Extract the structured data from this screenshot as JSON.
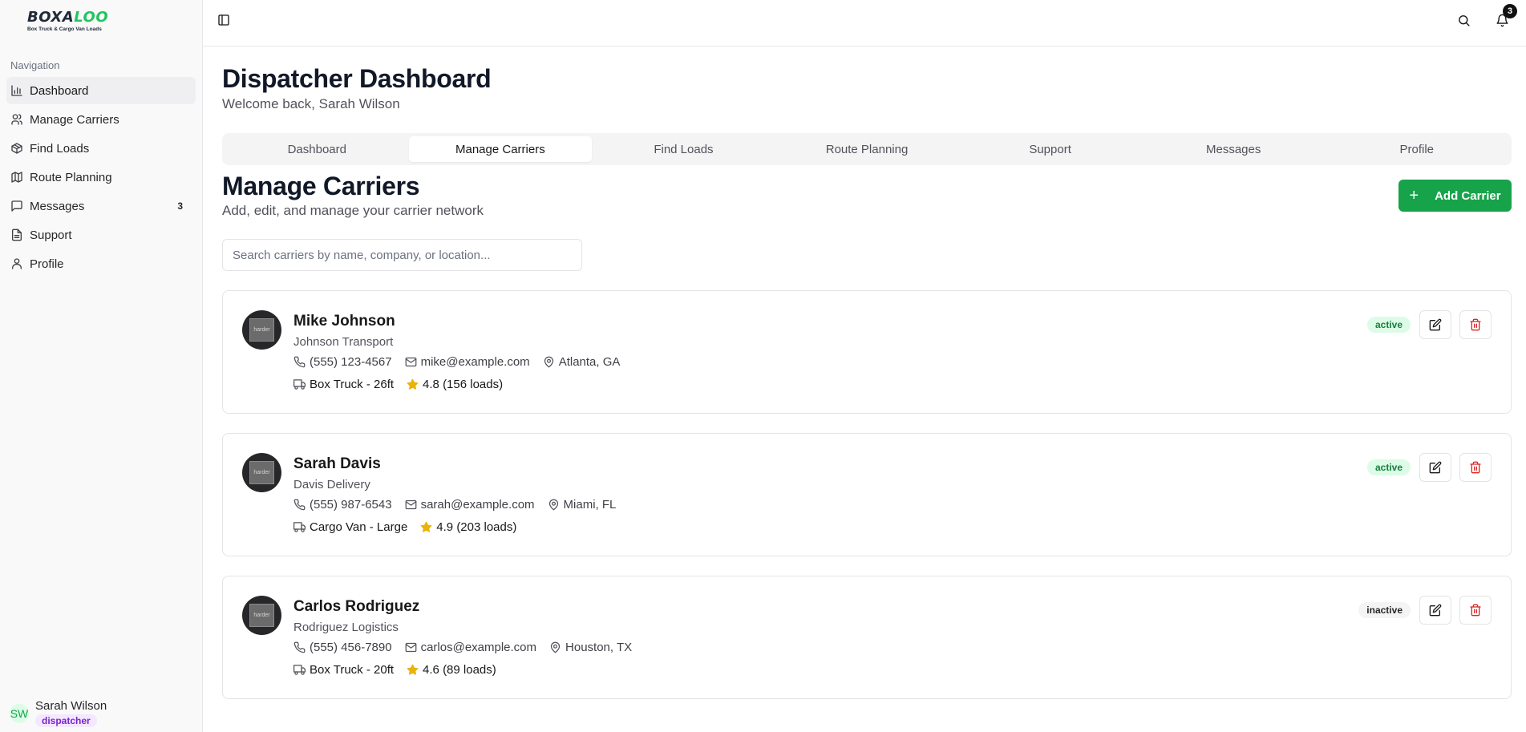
{
  "brand": {
    "logo_dark": "BOXA",
    "logo_green": "LOO",
    "tagline": "Box Truck & Cargo Van Loads"
  },
  "sidebar": {
    "heading": "Navigation",
    "items": [
      {
        "label": "Dashboard",
        "icon": "bar-chart-icon",
        "active": true
      },
      {
        "label": "Manage Carriers",
        "icon": "users-icon"
      },
      {
        "label": "Find Loads",
        "icon": "package-icon"
      },
      {
        "label": "Route Planning",
        "icon": "map-icon"
      },
      {
        "label": "Messages",
        "icon": "message-icon",
        "count": "3"
      },
      {
        "label": "Support",
        "icon": "document-icon"
      },
      {
        "label": "Profile",
        "icon": "user-icon"
      }
    ],
    "user": {
      "initials": "SW",
      "name": "Sarah Wilson",
      "role": "dispatcher"
    }
  },
  "topbar": {
    "notification_count": "3"
  },
  "header": {
    "title": "Dispatcher Dashboard",
    "subtitle": "Welcome back, Sarah Wilson"
  },
  "tabs": [
    {
      "label": "Dashboard"
    },
    {
      "label": "Manage Carriers",
      "active": true
    },
    {
      "label": "Find Loads"
    },
    {
      "label": "Route Planning"
    },
    {
      "label": "Support"
    },
    {
      "label": "Messages"
    },
    {
      "label": "Profile"
    }
  ],
  "carriers_section": {
    "title": "Manage Carriers",
    "subtitle": "Add, edit, and manage your carrier network",
    "add_button": "Add Carrier",
    "search_placeholder": "Search carriers by name, company, or location..."
  },
  "carriers": [
    {
      "avatar_text": "harder",
      "name": "Mike Johnson",
      "company": "Johnson Transport",
      "phone": "(555) 123-4567",
      "email": "mike@example.com",
      "location": "Atlanta, GA",
      "vehicle": "Box Truck - 26ft",
      "rating": "4.8 (156 loads)",
      "status": "active"
    },
    {
      "avatar_text": "harder",
      "name": "Sarah Davis",
      "company": "Davis Delivery",
      "phone": "(555) 987-6543",
      "email": "sarah@example.com",
      "location": "Miami, FL",
      "vehicle": "Cargo Van - Large",
      "rating": "4.9 (203 loads)",
      "status": "active"
    },
    {
      "avatar_text": "harder",
      "name": "Carlos Rodriguez",
      "company": "Rodriguez Logistics",
      "phone": "(555) 456-7890",
      "email": "carlos@example.com",
      "location": "Houston, TX",
      "vehicle": "Box Truck - 20ft",
      "rating": "4.6 (89 loads)",
      "status": "inactive"
    }
  ],
  "colors": {
    "accent": "#16a34a",
    "active_bg": "#dcfce7",
    "danger": "#dc2626",
    "star": "#eab308"
  }
}
